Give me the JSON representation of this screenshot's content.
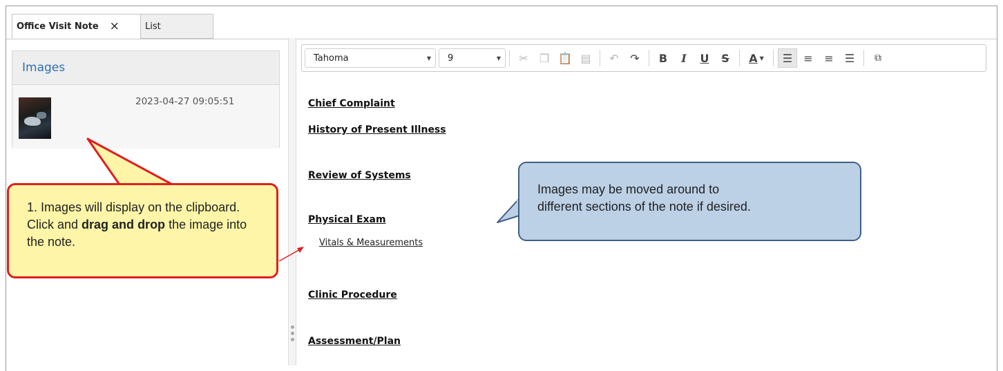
{
  "tabs": [
    {
      "label": "Office Visit Note",
      "close": "×"
    },
    {
      "label": "List"
    }
  ],
  "images_panel": {
    "title": "Images",
    "items": [
      {
        "timestamp": "2023-04-27 09:05:51"
      }
    ]
  },
  "toolbar": {
    "font": "Tahoma",
    "size": "9",
    "icons": [
      "cut-icon",
      "copy-icon",
      "paste-icon",
      "paste-special-icon",
      "undo-icon",
      "redo-icon",
      "bold-icon",
      "italic-icon",
      "underline-icon",
      "strikethrough-icon",
      "font-color-icon",
      "align-left-icon",
      "align-center-icon",
      "align-right-icon",
      "justify-icon",
      "insert-field-icon"
    ],
    "bold": "B",
    "italic": "I",
    "underline": "U",
    "strike": "S",
    "font_color": "A"
  },
  "note": {
    "sections": [
      "Chief Complaint",
      "History of Present Illness",
      "Review of Systems",
      "Physical Exam",
      "Clinic Procedure",
      "Assessment/Plan"
    ],
    "sub_items": [
      "Vitals & Measurements"
    ]
  },
  "callouts": {
    "red": {
      "before_1": "1. Images will display on the clipboard. Click and ",
      "bold_1": "drag and",
      "bold_2": "drop",
      "after_2": " the image into the note."
    },
    "blue": {
      "line1": "Images may be moved around to",
      "line2": "different sections of the note if desired."
    }
  },
  "colors": {
    "red_callout_border": "#e01e1e",
    "red_callout_fill": "#fff5a8",
    "blue_callout_fill": "#bcd0e6",
    "blue_callout_border": "#3f5f85",
    "panel_title": "#2d6fb3"
  }
}
